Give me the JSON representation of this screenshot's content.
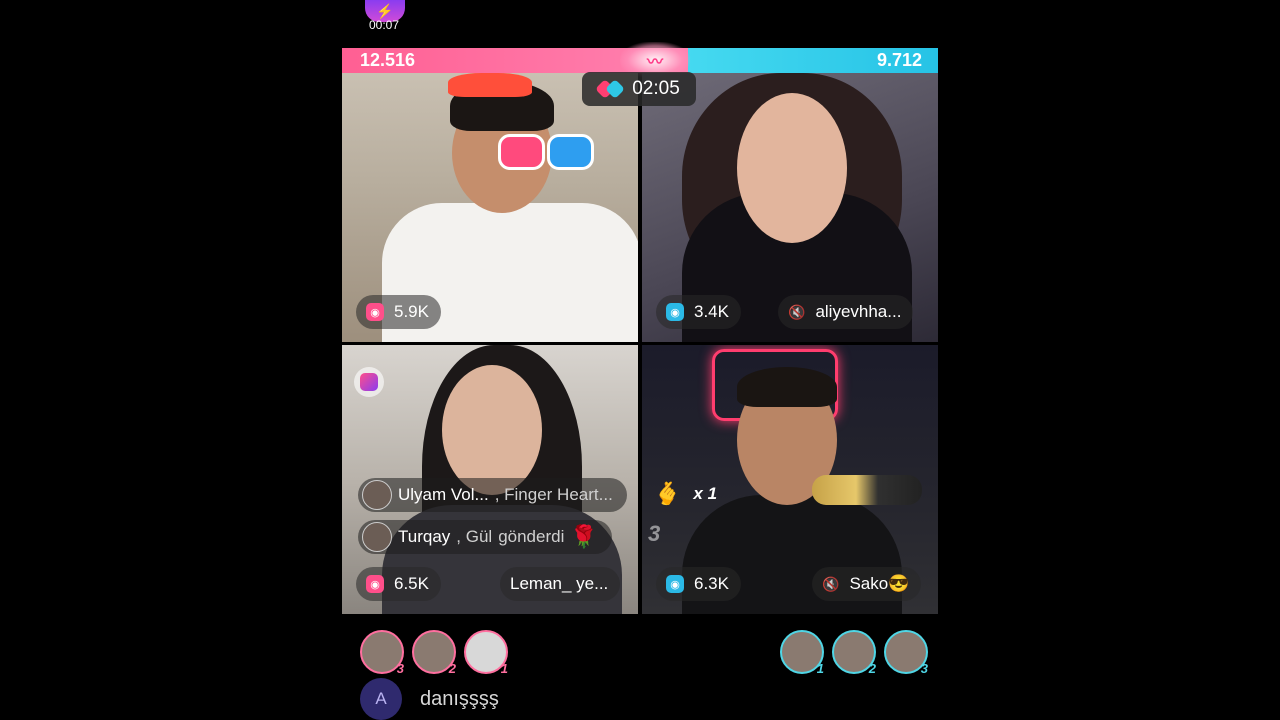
{
  "header": {
    "timer_badge": "00:07"
  },
  "battle": {
    "score_left": "12.516",
    "score_right": "9.712",
    "round_timer": "02:05",
    "left_color": "#ff5f93",
    "right_color": "#2bc6e7"
  },
  "tiles": [
    {
      "viewers": "5.9K",
      "coin_color": "pink"
    },
    {
      "viewers": "3.4K",
      "coin_color": "blue",
      "name": "aliyevhha..."
    },
    {
      "viewers": "6.5K",
      "coin_color": "pink",
      "name": "Leman_ ye..."
    },
    {
      "viewers": "6.3K",
      "coin_color": "blue",
      "name": "Sako😎"
    }
  ],
  "gifts": [
    {
      "user": "Ulyam  Vol...",
      "text": ", Finger Heart..."
    },
    {
      "user": "Turqay",
      "text_a": ", Gül",
      "text_b": "gönderdi"
    }
  ],
  "combo": {
    "count": "x 1",
    "number": "3"
  },
  "supporters_left": [
    {
      "rank": "3"
    },
    {
      "rank": "2"
    },
    {
      "rank": "1"
    }
  ],
  "supporters_right": [
    {
      "rank": "1"
    },
    {
      "rank": "2"
    },
    {
      "rank": "3"
    }
  ],
  "chat": {
    "avatar_letter": "A",
    "message": "danışşşş"
  },
  "icons": [
    "bolt-icon",
    "boxing-gloves-icon",
    "coin-icon",
    "mute-icon",
    "rose-icon",
    "finger-heart-icon"
  ]
}
